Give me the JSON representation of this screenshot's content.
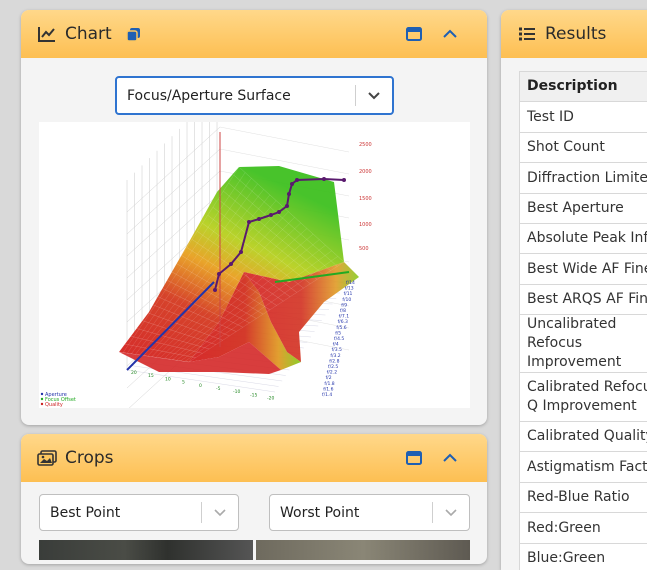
{
  "chart_panel": {
    "title": "Chart",
    "select_value": "Focus/Aperture Surface",
    "z_ticks": [
      "2500",
      "2000",
      "1500",
      "1000",
      "500"
    ],
    "aperture_ticks": [
      "f/14",
      "f/13",
      "f/11",
      "f/10",
      "f/9",
      "f/8",
      "f/7.1",
      "f/6.3",
      "f/5.6",
      "f/5",
      "f/4.5",
      "f/4",
      "f/3.5",
      "f/3.2",
      "f/2.8",
      "f/2.5",
      "f/2.2",
      "f/2",
      "f/1.8",
      "f/1.6",
      "f/1.4"
    ],
    "focus_ticks": [
      "20",
      "15",
      "10",
      "5",
      "0",
      "-5",
      "-10",
      "-15",
      "-20"
    ],
    "legend": [
      "Aperture",
      "Focus Offset",
      "Quality"
    ],
    "colors": {
      "aperture": "#2233aa",
      "focus_offset": "#22aa22",
      "quality": "#cc2222",
      "path": "#5a1a6e"
    }
  },
  "crops_panel": {
    "title": "Crops",
    "select_best": "Best Point",
    "select_worst": "Worst Point"
  },
  "results_panel": {
    "title": "Results",
    "header": "Description",
    "rows": [
      "Test ID",
      "Shot Count",
      "Diffraction Limited A",
      "Best Aperture",
      "Absolute Peak Info",
      "Best Wide AF Fine-T",
      "Best ARQS AF Fine-T",
      "Uncalibrated Refocus Improvement",
      "Calibrated Refocus Q Improvement",
      "Calibrated Quality In",
      "Astigmatism Factor",
      "Red-Blue Ratio",
      "Red:Green",
      "Blue:Green"
    ]
  },
  "accent_color": "#fdbf52",
  "focus_color": "#2f74d0"
}
